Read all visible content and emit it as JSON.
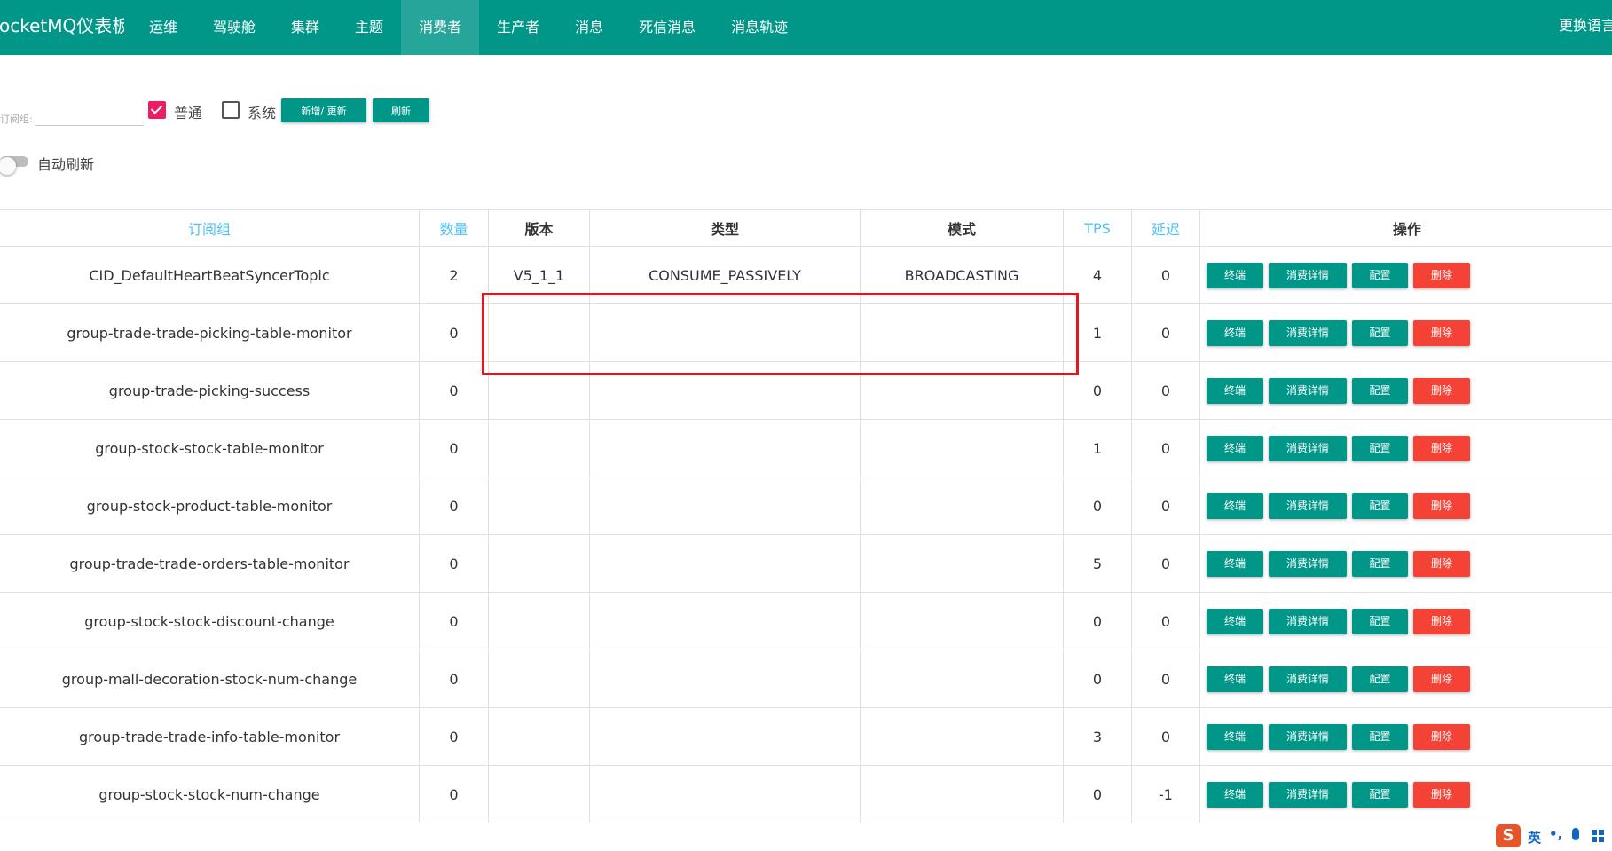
{
  "navbar": {
    "brand": "RocketMQ仪表板",
    "items": [
      {
        "label": "运维"
      },
      {
        "label": "驾驶舱"
      },
      {
        "label": "集群"
      },
      {
        "label": "主题"
      },
      {
        "label": "消费者"
      },
      {
        "label": "生产者"
      },
      {
        "label": "消息"
      },
      {
        "label": "死信消息"
      },
      {
        "label": "消息轨迹"
      }
    ],
    "active_item": "消费者",
    "language_button": "更换语言"
  },
  "filter": {
    "label": "订阅组:",
    "value": "",
    "normal_label": "普通",
    "normal_checked": true,
    "system_label": "系统",
    "system_checked": false,
    "add_update_label": "新增/ 更新",
    "refresh_label": "刷新",
    "auto_refresh_label": "自动刷新",
    "auto_refresh_on": false
  },
  "table": {
    "headers": [
      "订阅组",
      "数量",
      "版本",
      "类型",
      "模式",
      "TPS",
      "延迟",
      "操作"
    ],
    "sortable_headers": [
      "订阅组",
      "数量",
      "TPS",
      "延迟"
    ],
    "action_labels": {
      "terminal": "终端",
      "detail": "消费详情",
      "config": "配置",
      "delete": "删除"
    },
    "rows": [
      {
        "group": "CID_DefaultHeartBeatSyncerTopic",
        "count": "2",
        "version": "V5_1_1",
        "type": "CONSUME_PASSIVELY",
        "mode": "BROADCASTING",
        "tps": "4",
        "delay": "0"
      },
      {
        "group": "group-trade-trade-picking-table-monitor",
        "count": "0",
        "version": "",
        "type": "",
        "mode": "",
        "tps": "1",
        "delay": "0"
      },
      {
        "group": "group-trade-picking-success",
        "count": "0",
        "version": "",
        "type": "",
        "mode": "",
        "tps": "0",
        "delay": "0"
      },
      {
        "group": "group-stock-stock-table-monitor",
        "count": "0",
        "version": "",
        "type": "",
        "mode": "",
        "tps": "1",
        "delay": "0"
      },
      {
        "group": "group-stock-product-table-monitor",
        "count": "0",
        "version": "",
        "type": "",
        "mode": "",
        "tps": "0",
        "delay": "0"
      },
      {
        "group": "group-trade-trade-orders-table-monitor",
        "count": "0",
        "version": "",
        "type": "",
        "mode": "",
        "tps": "5",
        "delay": "0"
      },
      {
        "group": "group-stock-stock-discount-change",
        "count": "0",
        "version": "",
        "type": "",
        "mode": "",
        "tps": "0",
        "delay": "0"
      },
      {
        "group": "group-mall-decoration-stock-num-change",
        "count": "0",
        "version": "",
        "type": "",
        "mode": "",
        "tps": "0",
        "delay": "0"
      },
      {
        "group": "group-trade-trade-info-table-monitor",
        "count": "0",
        "version": "",
        "type": "",
        "mode": "",
        "tps": "3",
        "delay": "0"
      },
      {
        "group": "group-stock-stock-num-change",
        "count": "0",
        "version": "",
        "type": "",
        "mode": "",
        "tps": "0",
        "delay": "-1"
      }
    ]
  },
  "ime": {
    "logo": "S",
    "language": "英",
    "punctuation": "•,"
  },
  "colors": {
    "primary": "#009688",
    "danger": "#f44336",
    "checkbox": "#e91e63",
    "sortable_header": "#4fc3f7",
    "annotation": "#e8161c"
  }
}
